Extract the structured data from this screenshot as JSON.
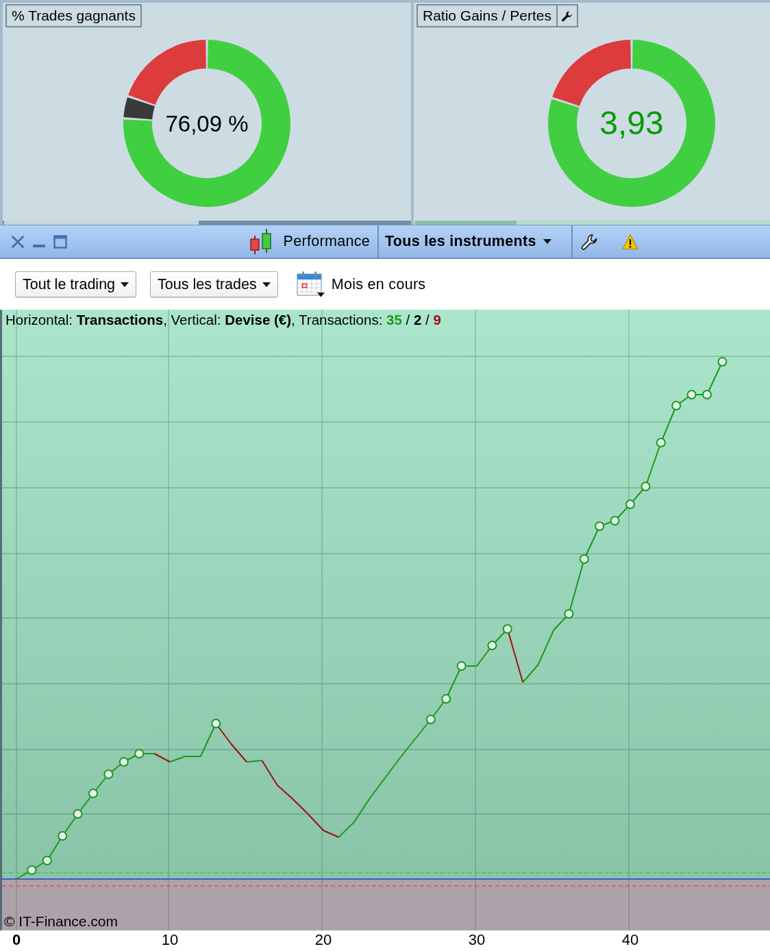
{
  "summary_panels": [
    {
      "kind": "win_rate",
      "title": "% Trades gagnants",
      "value": "76,09 %",
      "settings_button": false
    },
    {
      "kind": "ratio",
      "title": "Ratio Gains / Pertes",
      "value": "3,93",
      "settings_button": true
    }
  ],
  "toolbar": {
    "title": "Performance",
    "instrument_selector": "Tous les instruments"
  },
  "filters": {
    "dropdowns": [
      "Tout le trading",
      "Tous les trades"
    ],
    "period": "Mois en cours"
  },
  "chart": {
    "caption": "Horizontal: **Transactions**, Vertical: **Devise (€)**, Transactions:",
    "counts": [
      {
        "text": "35",
        "color": "#1f9a1f"
      },
      {
        "text": "2",
        "color": "#000000"
      },
      {
        "text": "9",
        "color": "#a00d0d"
      }
    ],
    "count_separators": [
      "/",
      "/"
    ],
    "watermark": "© IT-Finance.com",
    "x_axis_labels": [
      {
        "text": "0",
        "kind": "origin"
      },
      {
        "text": "10",
        "kind": "tick"
      },
      {
        "text": "20",
        "kind": "tick"
      },
      {
        "text": "30",
        "kind": "tick"
      },
      {
        "text": "40",
        "kind": "tick"
      }
    ]
  }
}
